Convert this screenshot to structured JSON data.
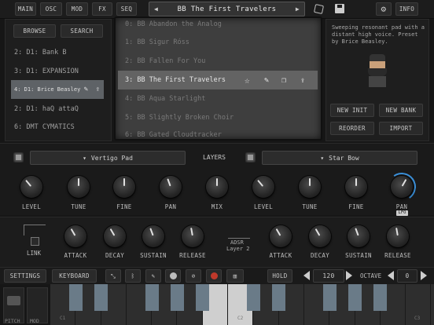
{
  "nav": {
    "tabs": [
      "MAIN",
      "OSC",
      "MOD",
      "FX",
      "SEQ"
    ],
    "preset_title": "BB The First Travelers",
    "info": "INFO",
    "prev": "◀",
    "next": "▶"
  },
  "browser": {
    "browse": "BROWSE",
    "search": "SEARCH",
    "banks": [
      "2: D1: Bank B",
      "3: D1: EXPANSION",
      "4: D1: Brice Beasley",
      "2: D1: haQ attaQ",
      "6: DMT CYMATICS"
    ],
    "presets": [
      "0: BB Abandon the Analog",
      "1: BB Sigur Róss",
      "2: BB Fallen For You",
      "3: BB The First Travelers",
      "4: BB Aqua Starlight",
      "5: BB Slightly Broken Choir",
      "6: BB Gated Cloudtracker"
    ],
    "description": "Sweeping resonant pad with a distant high voice. Preset by Brice Beasley.",
    "buttons": {
      "new_init": "NEW INIT",
      "new_bank": "NEW BANK",
      "reorder": "REORDER",
      "import": "IMPORT"
    }
  },
  "layers": {
    "title": "LAYERS",
    "left_patch": "Vertigo Pad",
    "right_patch": "Star Bow",
    "mix": "MIX",
    "left_knobs": [
      "LEVEL",
      "TUNE",
      "FINE",
      "PAN"
    ],
    "right_knobs": [
      "LEVEL",
      "TUNE",
      "FINE",
      "PAN"
    ],
    "lfo": "LFO"
  },
  "env": {
    "link": "LINK",
    "adsr": "ADSR",
    "layer2": "Layer 2",
    "left": [
      "ATTACK",
      "DECAY",
      "SUSTAIN",
      "RELEASE"
    ],
    "right": [
      "ATTACK",
      "DECAY",
      "SUSTAIN",
      "RELEASE"
    ]
  },
  "bottom": {
    "settings": "SETTINGS",
    "keyboard": "KEYBOARD",
    "hold": "HOLD",
    "tempo": "120",
    "octave_label": "OCTAVE",
    "octave": "0",
    "pitch": "PITCH",
    "mod": "MOD",
    "c_labels": [
      "C1",
      "C2",
      "C3"
    ]
  },
  "colors": {
    "accent": "#3a8fd8",
    "lcd": "#3e3e3e"
  }
}
